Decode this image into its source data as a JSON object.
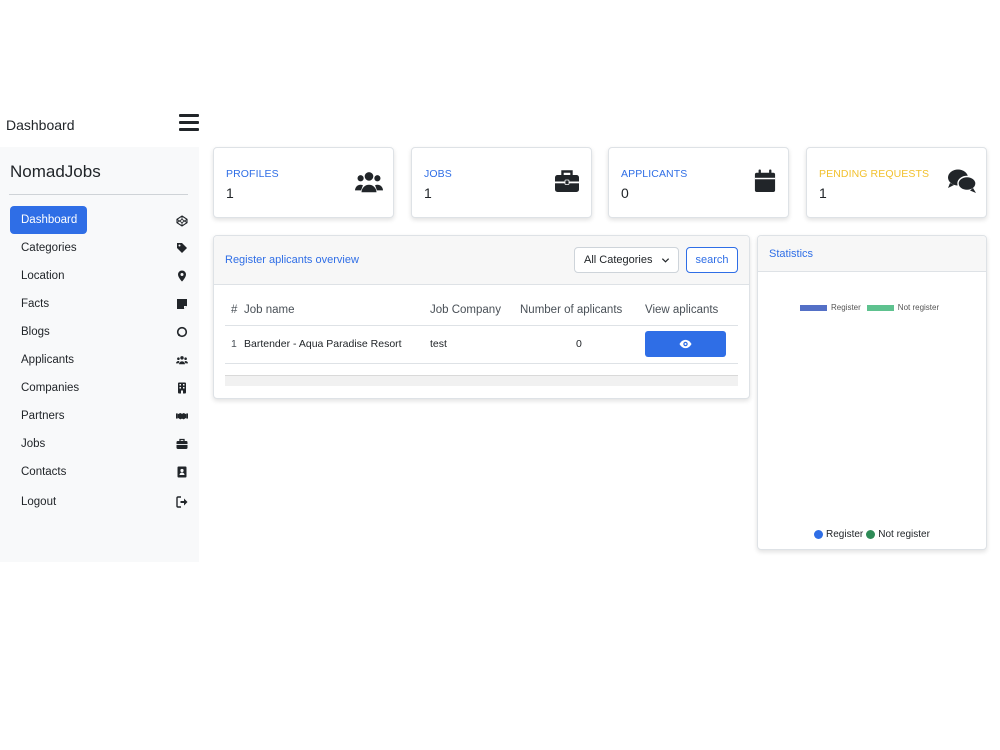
{
  "header": {
    "title": "Dashboard"
  },
  "sidebar": {
    "brand": "NomadJobs",
    "items": [
      {
        "label": "Dashboard",
        "icon": "codepen-icon",
        "active": true
      },
      {
        "label": "Categories",
        "icon": "tags-icon"
      },
      {
        "label": "Location",
        "icon": "map-pin-icon"
      },
      {
        "label": "Facts",
        "icon": "sticky-note-icon"
      },
      {
        "label": "Blogs",
        "icon": "comment-icon"
      },
      {
        "label": "Applicants",
        "icon": "users-icon"
      },
      {
        "label": "Companies",
        "icon": "building-icon"
      },
      {
        "label": "Partners",
        "icon": "handshake-icon"
      },
      {
        "label": "Jobs",
        "icon": "briefcase-icon"
      },
      {
        "label": "Contacts",
        "icon": "address-book-icon"
      },
      {
        "label": "Logout",
        "icon": "sign-out-icon"
      }
    ]
  },
  "stats": [
    {
      "label": "PROFILES",
      "value": "1",
      "icon": "users-icon",
      "color": "#2f6ee6"
    },
    {
      "label": "JOBS",
      "value": "1",
      "icon": "briefcase-icon",
      "color": "#2f6ee6"
    },
    {
      "label": "APPLICANTS",
      "value": "0",
      "icon": "calendar-icon",
      "color": "#2f6ee6"
    },
    {
      "label": "PENDING REQUESTS",
      "value": "1",
      "icon": "comments-icon",
      "color": "#f2c12e"
    }
  ],
  "overview": {
    "title": "Register aplicants overview",
    "filter": {
      "selected": "All Categories"
    },
    "search_label": "search",
    "columns": [
      "#",
      "Job name",
      "Job Company",
      "Number of aplicants",
      "View aplicants"
    ],
    "rows": [
      {
        "num": "1",
        "job_name": "Bartender - Aqua Paradise Resort",
        "company": "test",
        "applicants": "0"
      }
    ]
  },
  "statistics": {
    "title": "Statistics",
    "legend_top": [
      "Register",
      "Not register"
    ],
    "legend_bottom": [
      "Register",
      "Not register"
    ]
  },
  "colors": {
    "primary": "#2f6ee6",
    "warning": "#f2c12e",
    "register": "#5470c6",
    "not_register": "#5ec28f",
    "register_dot": "#2f6ee6",
    "not_register_dot": "#2e8b57"
  }
}
